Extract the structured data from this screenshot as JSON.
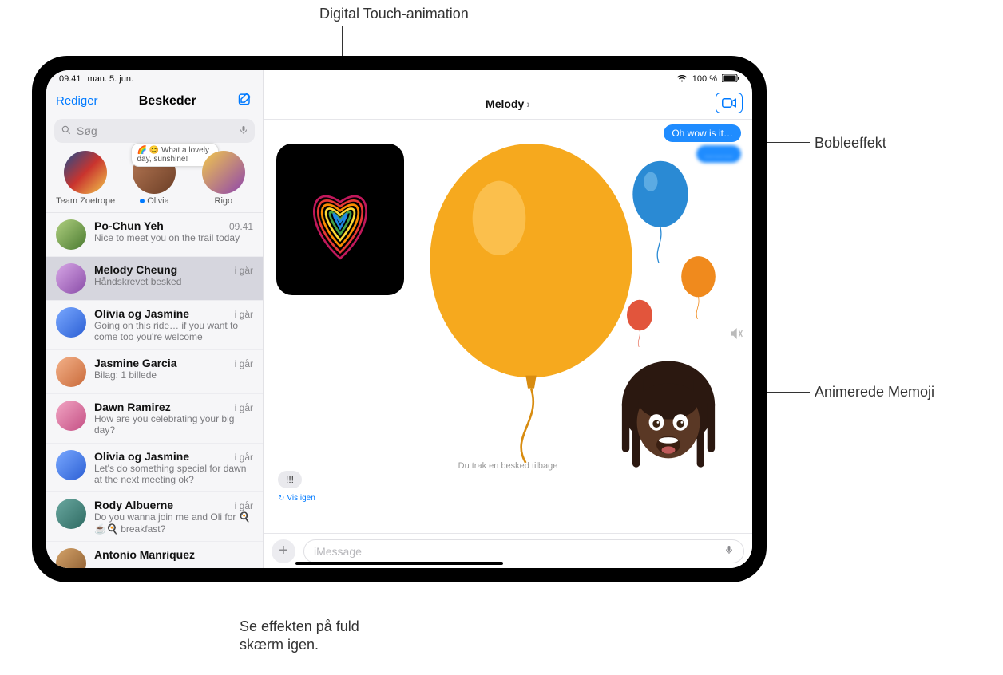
{
  "callouts": {
    "top": "Digital Touch-animation",
    "right1": "Bobleeffekt",
    "right2": "Animerede Memoji",
    "bottom": "Se effekten på fuld\nskærm igen."
  },
  "status": {
    "time": "09.41",
    "date": "man. 5. jun.",
    "wifi": "wifi-icon",
    "battery_pct": "100 %"
  },
  "sidebar": {
    "edit": "Rediger",
    "title": "Beskeder",
    "compose": "compose-icon",
    "search_placeholder": "Søg",
    "pinned": [
      {
        "name": "Team Zoetrope"
      },
      {
        "name": "Olivia",
        "bubble": "🌈 😊 What a lovely day, sunshine!"
      },
      {
        "name": "Rigo"
      }
    ],
    "conversations": [
      {
        "name": "Po-Chun Yeh",
        "time": "09.41",
        "preview": "Nice to meet you on the trail today"
      },
      {
        "name": "Melody Cheung",
        "time": "i går",
        "preview": "Håndskrevet besked",
        "active": true
      },
      {
        "name": "Olivia og Jasmine",
        "time": "i går",
        "preview": "Going on this ride… if you want to come too you're welcome"
      },
      {
        "name": "Jasmine Garcia",
        "time": "i går",
        "preview": "Bilag: 1 billede"
      },
      {
        "name": "Dawn Ramirez",
        "time": "i går",
        "preview": "How are you celebrating your big day?"
      },
      {
        "name": "Olivia og Jasmine",
        "time": "i går",
        "preview": "Let's do something special for dawn at the next meeting ok?"
      },
      {
        "name": "Rody Albuerne",
        "time": "i går",
        "preview": "Do you wanna join me and Oli for 🍳☕🍳 breakfast?"
      },
      {
        "name": "Antonio Manriquez",
        "time": "",
        "preview": ""
      }
    ]
  },
  "chat": {
    "title": "Melody",
    "video": "facetime-icon",
    "sent1": "Oh wow is it…",
    "sent2": "………",
    "tiny_exclaim": "!!!",
    "replay": "Vis igen",
    "recalled": "Du trak en besked tilbage",
    "input_placeholder": "iMessage"
  },
  "colors": {
    "link": "#007aff",
    "balloon_big": "#f6a91e",
    "balloon_blue": "#2a8ad4",
    "balloon_orange": "#f08a1d",
    "balloon_red": "#e2553c"
  }
}
